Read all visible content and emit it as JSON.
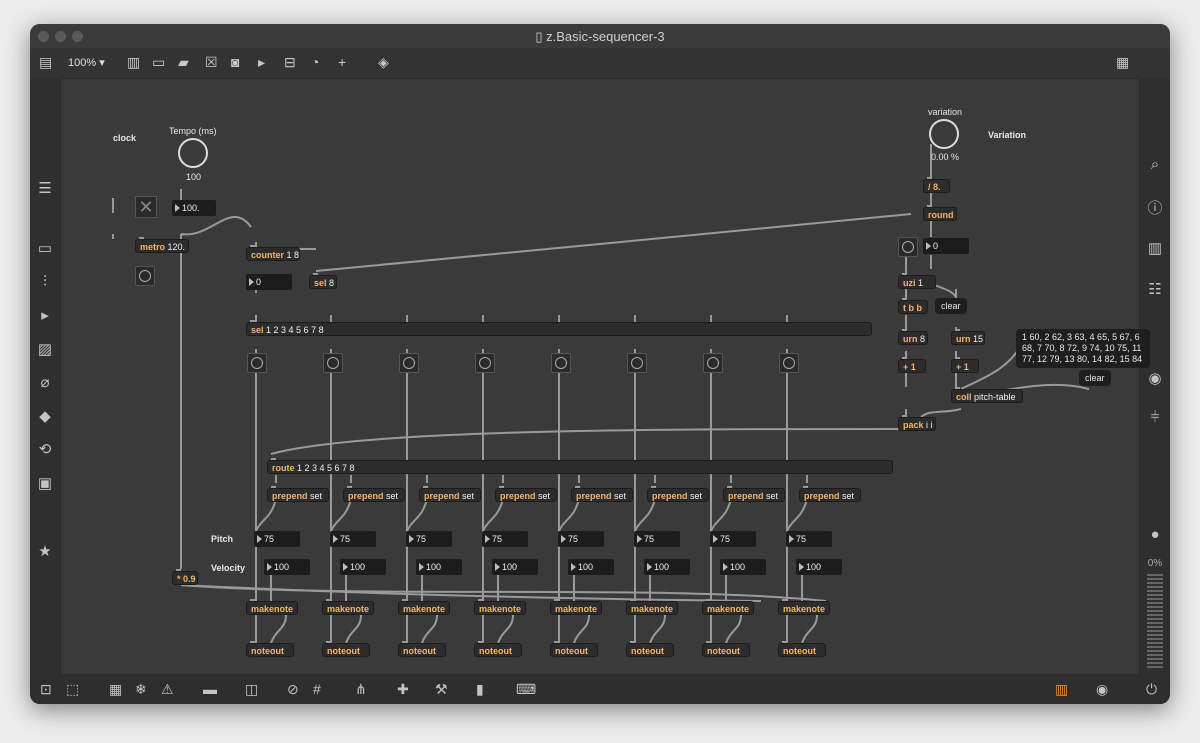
{
  "window": {
    "title": "z.Basic-sequencer-3",
    "zoom": "100%"
  },
  "labels": {
    "clock": "clock",
    "tempo": "Tempo (ms)",
    "tempo_value": "100",
    "variation_dial": "variation",
    "variation_value": "0.00 %",
    "variation": "Variation",
    "pitch": "Pitch",
    "velocity": "Velocity"
  },
  "objects": {
    "metro": "metro",
    "metro_arg": "120.",
    "counter": "counter",
    "counter_arg": "1 8",
    "sel8": "sel",
    "sel8_arg": "8",
    "sel_main": "sel",
    "sel_main_arg": "1 2 3 4 5 6 7 8",
    "route": "route",
    "route_arg": "1 2 3 4 5 6 7 8",
    "div": "/ 8.",
    "round": "round",
    "uzi": "uzi",
    "uzi_arg": "1",
    "tbb": "t b b",
    "urn8": "urn",
    "urn8_arg": "8",
    "urn15": "urn",
    "urn15_arg": "15",
    "plus1a": "+ 1",
    "plus1b": "+ 1",
    "coll": "coll",
    "coll_arg": "pitch-table",
    "pack": "pack",
    "pack_arg": "i i",
    "mul": "* 0.9",
    "prepend": "prepend",
    "prepend_arg": "set",
    "makenote": "makenote",
    "noteout": "noteout"
  },
  "numbers": {
    "tempo_box": "100.",
    "counter_out": "0",
    "uzi_in": "0",
    "pitch": "75",
    "velocity": "100"
  },
  "messages": {
    "clear1": "clear",
    "clear2": "clear",
    "pitch_table": "1 60, 2 62, 3 63, 4 65, 5 67, 6 68, 7 70, 8 72, 9 74, 10 75, 11 77, 12 79, 13 80, 14 82, 15 84"
  },
  "status": {
    "cpu": "0%"
  },
  "colors": {
    "accent": "#f08c28",
    "object_name": "#f4b46a"
  },
  "icons": {
    "toolbar": [
      "sidebar-icon",
      "presentation-icon",
      "comment-icon",
      "message-icon",
      "toggle-icon",
      "button-icon",
      "number-icon",
      "slider-icon",
      "dial-icon",
      "add-icon",
      "paint-icon",
      "grid-keyboard-icon"
    ],
    "left": [
      "menu-icon",
      "browser-icon",
      "audio-icon",
      "playlist-icon",
      "image-icon",
      "paperclip-icon",
      "plug-icon",
      "loop-icon",
      "package-icon",
      "star-icon"
    ],
    "right": [
      "search-icon",
      "info-icon",
      "book-icon",
      "list-icon",
      "camera-icon",
      "mixer-icon",
      "record-icon"
    ],
    "bottom": [
      "lock-icon",
      "edit-icon",
      "present-icon",
      "freeze-icon",
      "warning-icon",
      "presentation-icon",
      "layers-icon",
      "hide-icon",
      "grid-icon",
      "tree-icon",
      "add-wire-icon",
      "wrench-icon",
      "piano-icon",
      "keyboard-icon",
      "mixer-bars-icon",
      "play-icon",
      "power-icon"
    ]
  }
}
